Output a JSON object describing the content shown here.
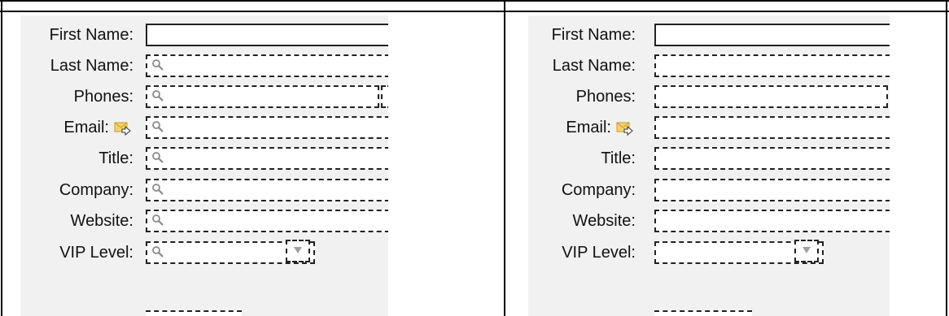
{
  "panels": [
    {
      "id": "left",
      "fields": [
        {
          "label": "First Name:",
          "style": "solid",
          "search_icon": false
        },
        {
          "label": "Last Name:",
          "style": "dashed",
          "search_icon": true
        },
        {
          "label": "Phones:",
          "style": "dashed",
          "search_icon": true
        },
        {
          "label": "Email:",
          "style": "dashed",
          "search_icon": true
        },
        {
          "label": "Title:",
          "style": "dashed",
          "search_icon": true
        },
        {
          "label": "Company:",
          "style": "dashed",
          "search_icon": true
        },
        {
          "label": "Website:",
          "style": "dashed",
          "search_icon": true
        },
        {
          "label": "VIP Level:",
          "style": "dashed",
          "search_icon": true
        }
      ]
    },
    {
      "id": "right",
      "fields": [
        {
          "label": "First Name:",
          "style": "solid",
          "search_icon": false
        },
        {
          "label": "Last Name:",
          "style": "dashed",
          "search_icon": false
        },
        {
          "label": "Phones:",
          "style": "dashed",
          "search_icon": false
        },
        {
          "label": "Email:",
          "style": "dashed",
          "search_icon": false
        },
        {
          "label": "Title:",
          "style": "dashed",
          "search_icon": false
        },
        {
          "label": "Company:",
          "style": "dashed",
          "search_icon": false
        },
        {
          "label": "Website:",
          "style": "dashed",
          "search_icon": false
        },
        {
          "label": "VIP Level:",
          "style": "dashed",
          "search_icon": false
        }
      ]
    }
  ],
  "icons": {
    "email": "email-compose-icon",
    "search": "magnifier-icon",
    "dropdown": "dropdown-arrow-icon"
  },
  "colors": {
    "panel_bg": "#f1f1f1",
    "field_bg": "#ffffff",
    "border": "#222222",
    "email_icon": "#f2c14a"
  }
}
